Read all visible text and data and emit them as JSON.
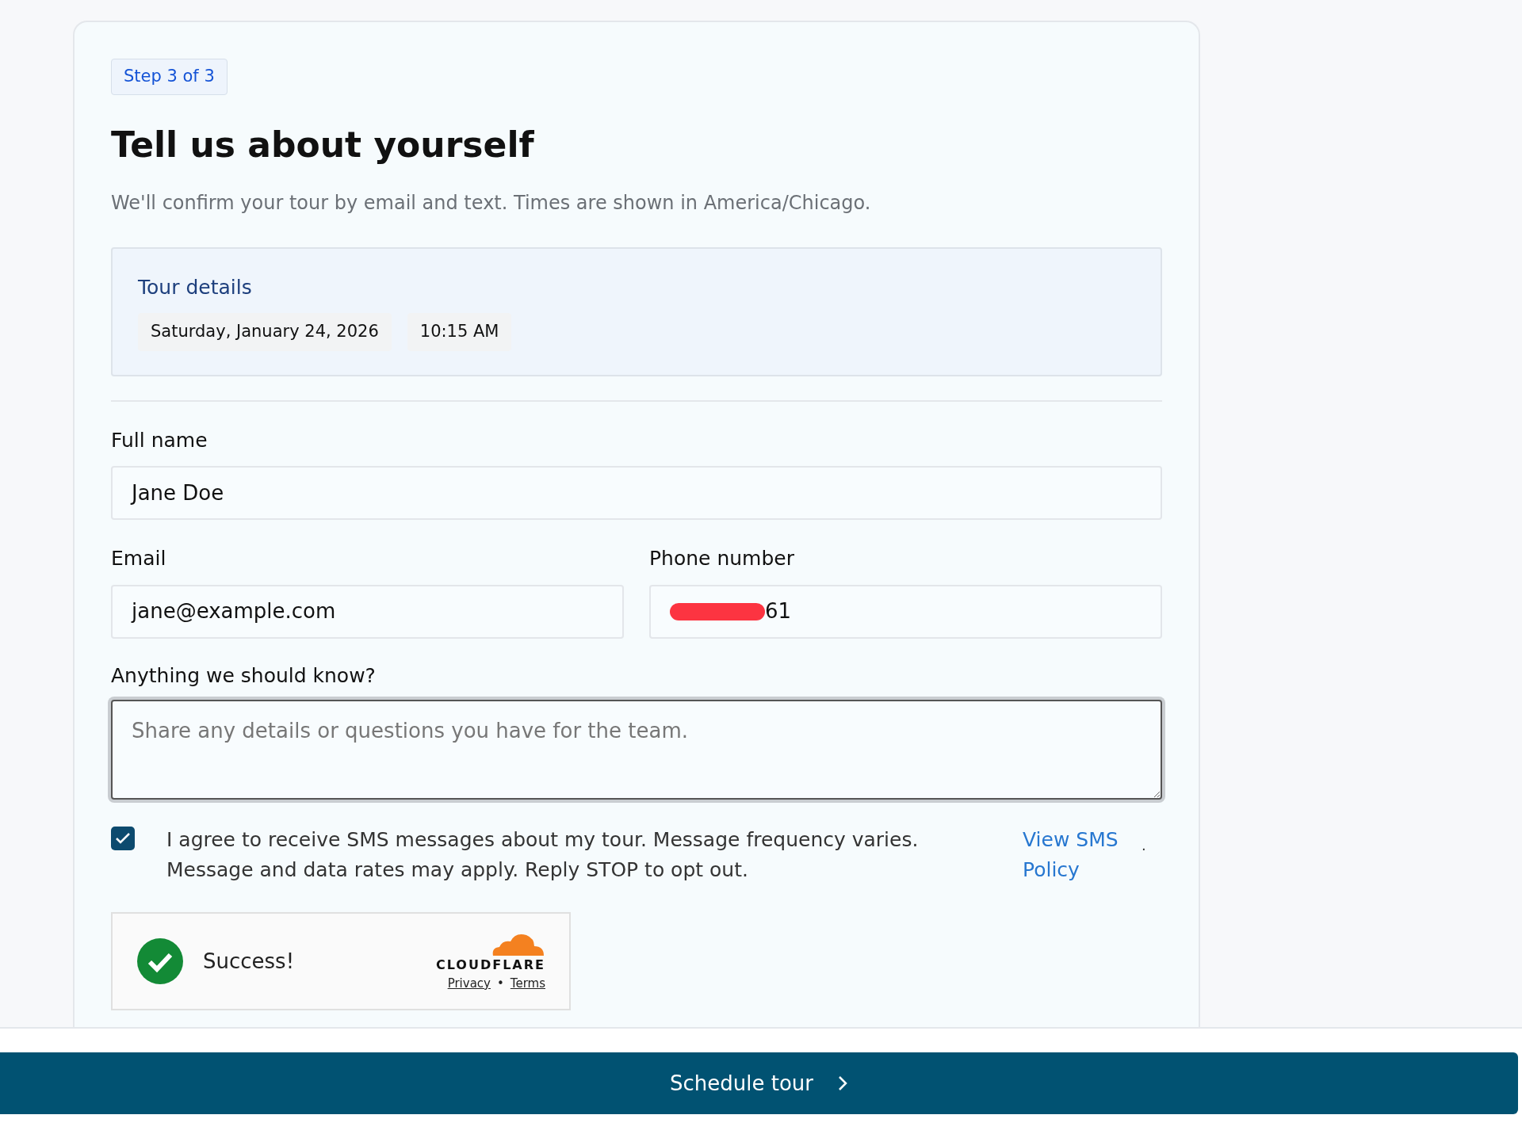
{
  "step_badge": "Step 3 of 3",
  "title": "Tell us about yourself",
  "subtitle": "We'll confirm your tour by email and text. Times are shown in America/Chicago.",
  "tour_details": {
    "heading": "Tour details",
    "chips": [
      "Saturday, January 24, 2026",
      "10:15 AM"
    ]
  },
  "fields": [
    {
      "label": "Full name",
      "value": "Jane Doe"
    },
    {
      "label": "Email",
      "value": "jane@example.com"
    },
    {
      "label": "Phone number",
      "value": "61",
      "redacted": true
    }
  ],
  "notes": {
    "label": "Anything we should know?",
    "placeholder": "Share any details or questions you have for the team.",
    "focused": true
  },
  "sms_consent": {
    "checked": true,
    "text": "I agree to receive SMS messages about my tour. Message frequency varies. Message and data rates may apply. Reply STOP to opt out.",
    "link": "View SMS Policy",
    "trailing": "."
  },
  "captcha": {
    "status": "Success!",
    "brand": "CLOUDFLARE",
    "links": [
      "Privacy",
      "Terms"
    ],
    "separator": "•"
  },
  "submit_button": {
    "label": "Schedule tour"
  }
}
